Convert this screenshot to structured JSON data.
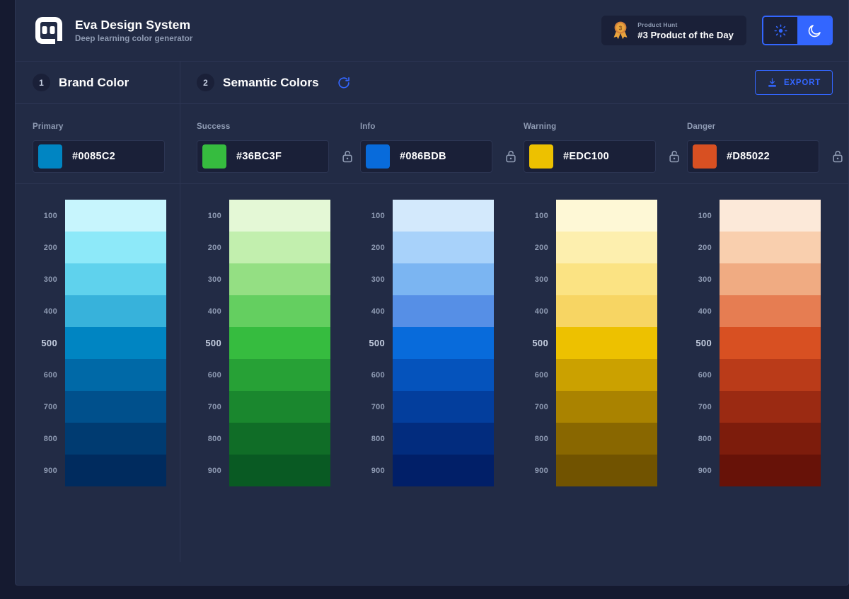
{
  "app": {
    "title": "Eva Design System",
    "subtitle": "Deep learning color generator",
    "logo_icon": "eva-logo-icon"
  },
  "header": {
    "product_hunt": {
      "medal_icon": "product-hunt-medal-icon",
      "kicker": "Product Hunt",
      "title": "#3 Product of the Day"
    },
    "theme_toggle": {
      "light_icon": "sun-icon",
      "dark_icon": "moon-icon",
      "active": "dark"
    }
  },
  "sections": {
    "brand": {
      "step": "1",
      "title": "Brand Color"
    },
    "semantic": {
      "step": "2",
      "title": "Semantic Colors",
      "refresh_icon": "refresh-icon"
    },
    "export": {
      "label": "EXPORT",
      "icon": "download-icon"
    }
  },
  "colors": {
    "accent": "#3366ff",
    "card_bg": "#222b45",
    "page_bg": "#151a30",
    "field_bg": "#1a2038",
    "border": "#2c3553",
    "text_primary": "#ffffff",
    "text_muted": "#8f9bb3"
  },
  "shade_labels": [
    "100",
    "200",
    "300",
    "400",
    "500",
    "600",
    "700",
    "800",
    "900"
  ],
  "palettes": [
    {
      "name": "Primary",
      "group": "brand",
      "hex": "#0085C2",
      "locked": false,
      "lock_icon": "unlock-icon",
      "shades": [
        "#C7F5FD",
        "#8DE9F9",
        "#5FD2ED",
        "#37B2DB",
        "#0085C2",
        "#0069A7",
        "#00508C",
        "#003B71",
        "#002B5E"
      ]
    },
    {
      "name": "Success",
      "group": "semantic",
      "hex": "#36BC3F",
      "locked": false,
      "lock_icon": "unlock-icon",
      "shades": [
        "#E4F8D6",
        "#C2EFAE",
        "#94DF83",
        "#64CF60",
        "#36BC3F",
        "#27A136",
        "#1A872E",
        "#106D27",
        "#095A23"
      ]
    },
    {
      "name": "Info",
      "group": "semantic",
      "hex": "#086BDB",
      "locked": false,
      "lock_icon": "unlock-icon",
      "shades": [
        "#D3E9FC",
        "#A8D2FA",
        "#7BB5F2",
        "#568FE6",
        "#086BDB",
        "#0553BC",
        "#033E9D",
        "#022C7E",
        "#011F68"
      ]
    },
    {
      "name": "Warning",
      "group": "semantic",
      "hex": "#EDC100",
      "locked": false,
      "lock_icon": "unlock-icon",
      "shades": [
        "#FEF8D6",
        "#FDEFAE",
        "#FBE383",
        "#F7D563",
        "#EDC100",
        "#CBA100",
        "#AA8300",
        "#896700",
        "#715300"
      ]
    },
    {
      "name": "Danger",
      "group": "semantic",
      "hex": "#D85022",
      "locked": false,
      "lock_icon": "unlock-icon",
      "shades": [
        "#FCE9D9",
        "#F9CFAE",
        "#F0AB82",
        "#E67D52",
        "#D85022",
        "#BA3B19",
        "#9B2A12",
        "#7D1C0C",
        "#671208"
      ]
    }
  ]
}
